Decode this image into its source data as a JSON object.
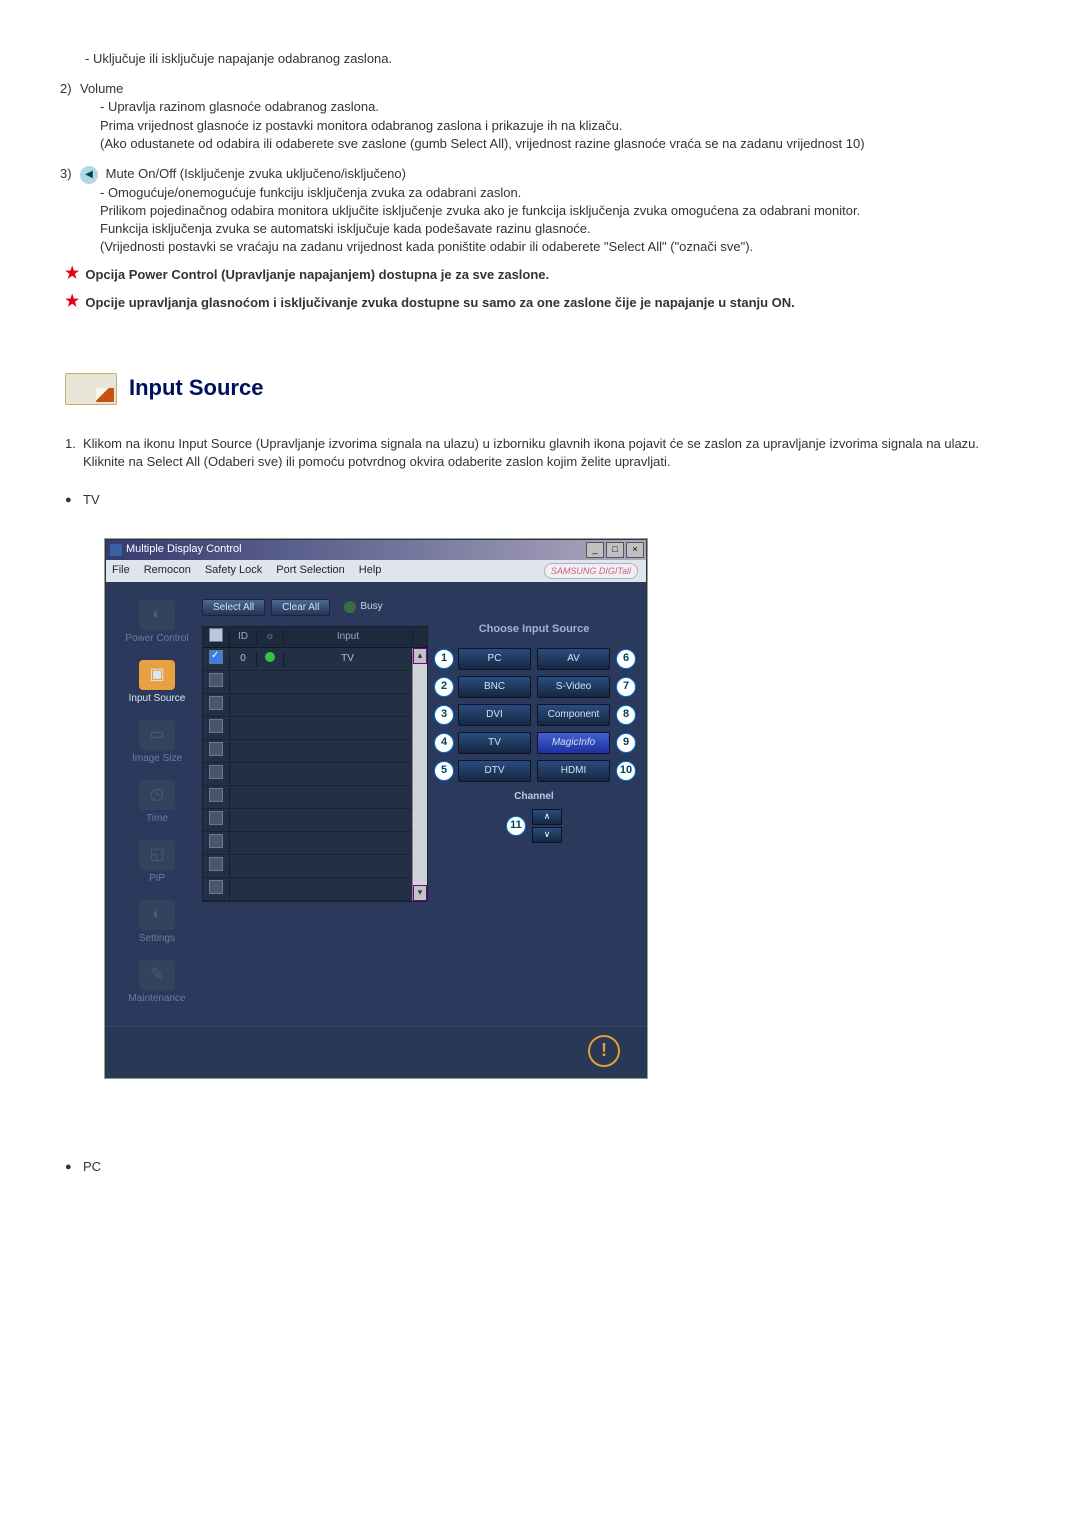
{
  "intro_line": "- Uključuje ili isključuje napajanje odabranog zaslona.",
  "item2": {
    "num": "2)",
    "title": "Volume",
    "lines": [
      "- Upravlja razinom glasnoće odabranog zaslona.",
      "Prima vrijednost glasnoće iz postavki monitora odabranog zaslona i prikazuje ih na klizaču.",
      "(Ako odustanete od odabira ili odaberete sve zaslone (gumb Select All), vrijednost razine glasnoće vraća se na zadanu vrijednost 10)"
    ]
  },
  "item3": {
    "num": "3)",
    "title": "Mute On/Off (Isključenje zvuka uključeno/isključeno)",
    "lines": [
      "- Omogućuje/onemogućuje funkciju isključenja zvuka za odabrani zaslon.",
      "Prilikom pojedinačnog odabira monitora uključite isključenje zvuka ako je funkcija isključenja zvuka omogućena za odabrani monitor.",
      "Funkcija isključenja zvuka se automatski isključuje kada podešavate razinu glasnoće.",
      "(Vrijednosti postavki se vraćaju na zadanu vrijednost kada poništite odabir ili odaberete \"Select All\" (\"označi sve\")."
    ]
  },
  "star1": "Opcija Power Control (Upravljanje napajanjem) dostupna je za sve zaslone.",
  "star2": "Opcije upravljanja glasnoćom i isključivanje zvuka dostupne su samo za one zaslone čije je napajanje u stanju ON.",
  "section_title": "Input Source",
  "step1_num": "1.",
  "step1_a": "Klikom na ikonu Input Source (Upravljanje izvorima signala na ulazu) u izborniku glavnih ikona pojavit će se zaslon za upravljanje izvorima signala na ulazu.",
  "step1_b": "Kliknite na Select All (Odaberi sve) ili pomoću potvrdnog okvira odaberite zaslon kojim želite upravljati.",
  "bullet_tv": "TV",
  "app": {
    "window_title": "Multiple Display Control",
    "menu": {
      "file": "File",
      "remocon": "Remocon",
      "safety": "Safety Lock",
      "port": "Port Selection",
      "help": "Help"
    },
    "brand": "SAMSUNG DIGITall",
    "toolbar": {
      "select_all": "Select All",
      "clear_all": "Clear All",
      "busy": "Busy"
    },
    "sidebar": [
      {
        "label": "Power Control"
      },
      {
        "label": "Input Source"
      },
      {
        "label": "Image Size"
      },
      {
        "label": "Time"
      },
      {
        "label": "PIP"
      },
      {
        "label": "Settings"
      },
      {
        "label": "Maintenance"
      }
    ],
    "table": {
      "headers": {
        "chk": "☑",
        "id": "ID",
        "pwr": "☀",
        "input": "Input"
      },
      "rows": [
        {
          "chk": true,
          "id": "0",
          "on": true,
          "input": "TV"
        },
        {
          "chk": null
        },
        {
          "chk": null
        },
        {
          "chk": null
        },
        {
          "chk": null
        },
        {
          "chk": null
        },
        {
          "chk": null
        },
        {
          "chk": null
        },
        {
          "chk": null
        },
        {
          "chk": null
        },
        {
          "chk": null
        }
      ]
    },
    "right": {
      "heading": "Choose Input Source",
      "buttons": {
        "pc": "PC",
        "bnc": "BNC",
        "dvi": "DVI",
        "tv": "TV",
        "dtv": "DTV",
        "av": "AV",
        "svideo": "S-Video",
        "component": "Component",
        "magicinfo": "MagicInfo",
        "hdmi": "HDMI"
      },
      "channel_label": "Channel"
    }
  },
  "bullet_pc": "PC"
}
